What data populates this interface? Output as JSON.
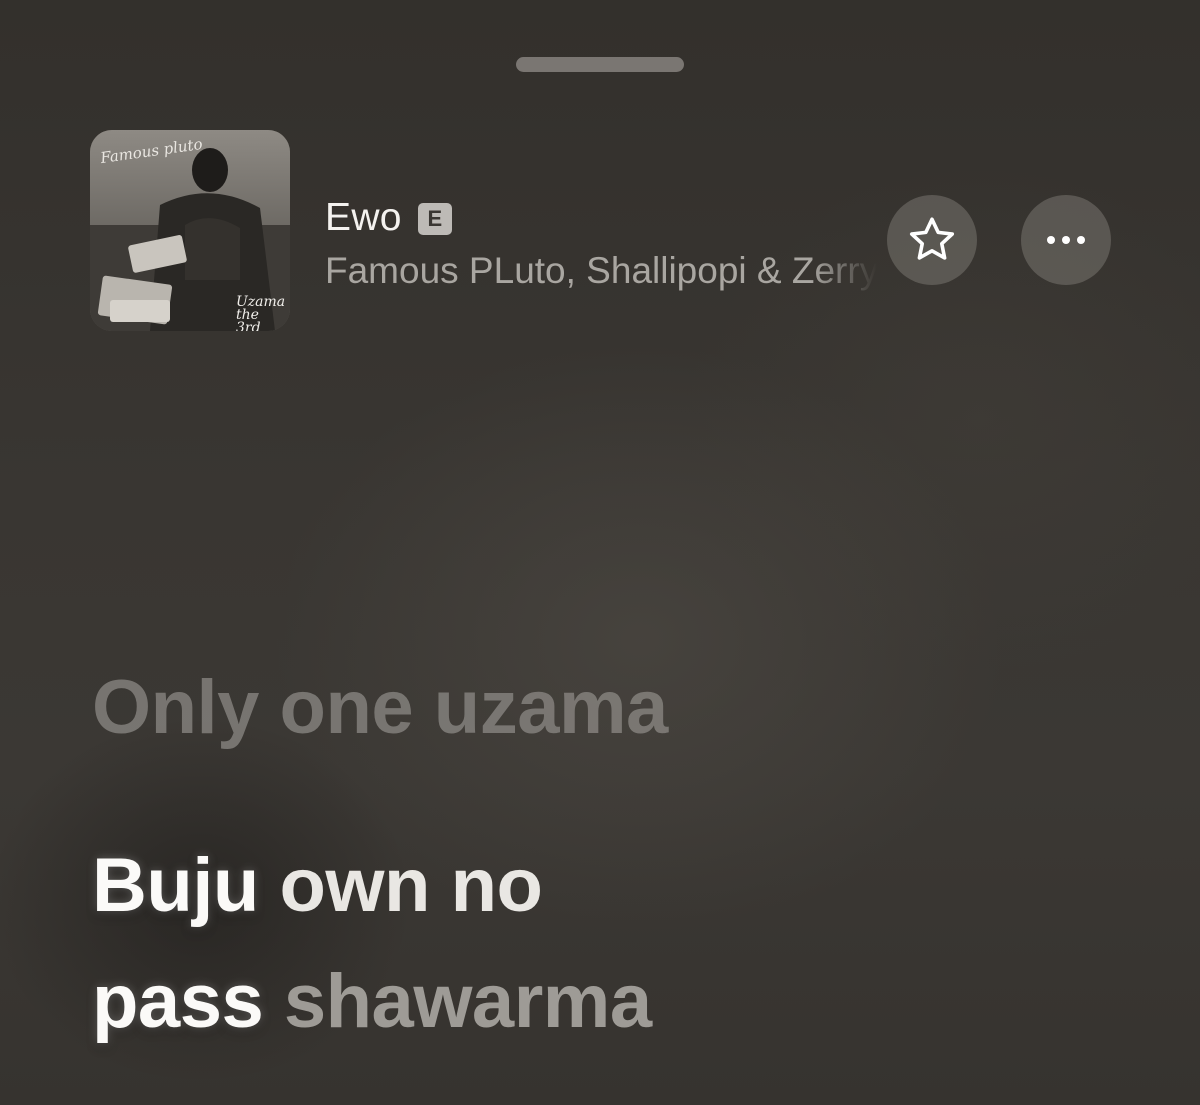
{
  "now_playing": {
    "title": "Ewo",
    "explicit_badge": "E",
    "artists": "Famous PLuto, Shallipopi & Zerrydl",
    "artwork": {
      "text_top": "Famous pluto",
      "text_bottom": "Uzama the 3rd"
    }
  },
  "actions": {
    "favorite_icon": "star-outline-icon",
    "more_icon": "ellipsis-icon"
  },
  "lyrics": {
    "previous_line": "Only one uzama",
    "current_line_1": {
      "sung": "Buju",
      "rest": "own no"
    },
    "current_line_2": {
      "sung": "pass",
      "rest": "shawarma"
    }
  }
}
